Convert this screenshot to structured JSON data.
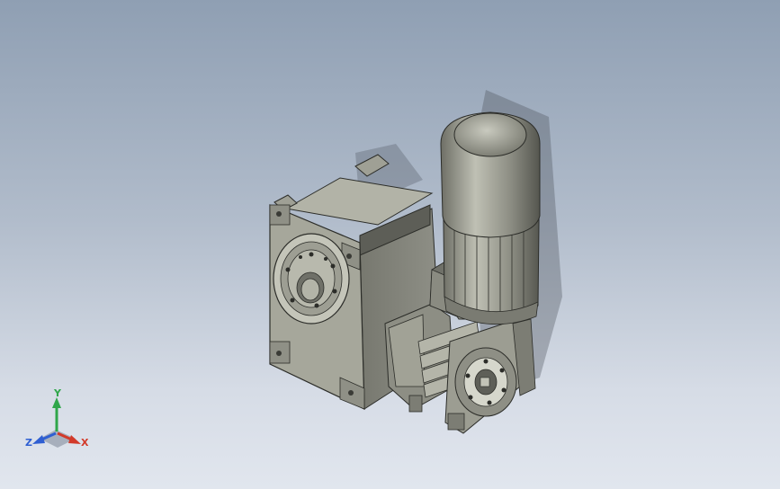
{
  "viewport": {
    "background_top": "#8f9fb3",
    "background_bottom": "#e1e6ee",
    "model": {
      "description_icon": "gear-reducer-assembly",
      "body_color": "#8a8b80",
      "face_color": "#a7a89c",
      "dark_color": "#3a3b36",
      "motor_color": "#9a9b90"
    }
  },
  "triad": {
    "x_label": "X",
    "y_label": "Y",
    "z_label": "Z",
    "x_color": "#d23a2a",
    "y_color": "#2fa64a",
    "z_color": "#2f5fd2"
  }
}
